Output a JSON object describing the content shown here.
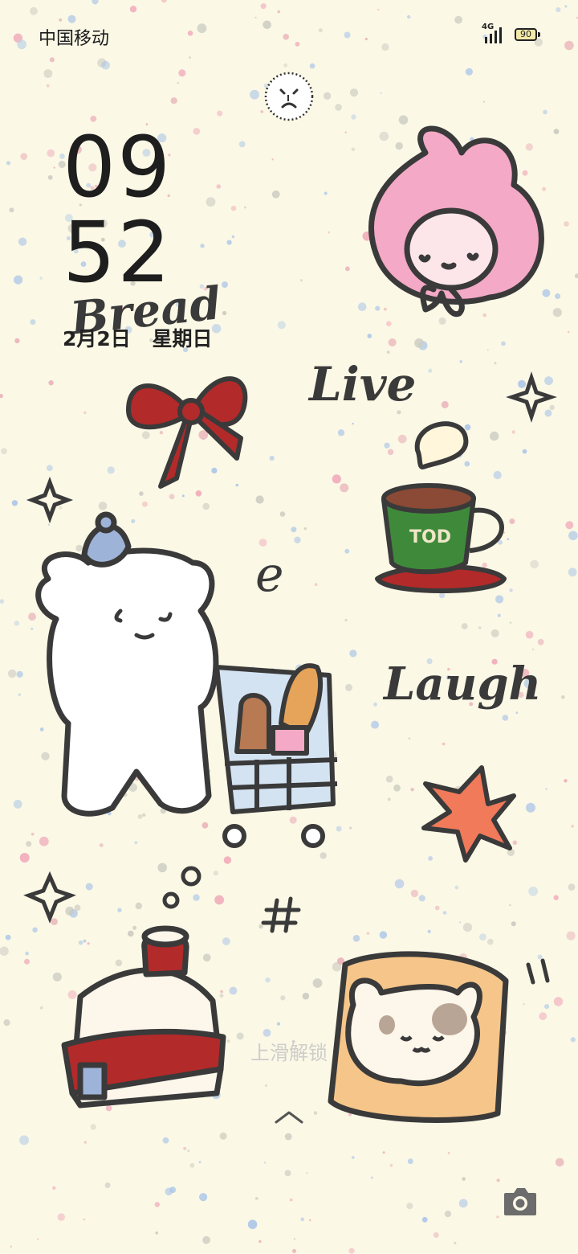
{
  "status_bar": {
    "carrier": "中国移动",
    "network": "4G",
    "battery": "90"
  },
  "lockscreen": {
    "clock_hour": "09",
    "clock_minute": "52",
    "date": "2月2日",
    "weekday": "星期日",
    "unlock_hint": "上滑解锁"
  },
  "wallpaper": {
    "words": [
      "Bread",
      "Live",
      "Laugh"
    ],
    "cup_label": "TOD",
    "colors": {
      "background": "#fbf8e6",
      "bunny_pink": "#f4a9c6",
      "bow_red": "#b22a2a",
      "cup_green": "#3f8a3a",
      "star_orange": "#f07a5a",
      "bread_orange": "#f5c58a"
    }
  },
  "icons": [
    "face-icon",
    "signal-icon",
    "battery-icon",
    "swipe-up-icon",
    "camera-icon"
  ]
}
